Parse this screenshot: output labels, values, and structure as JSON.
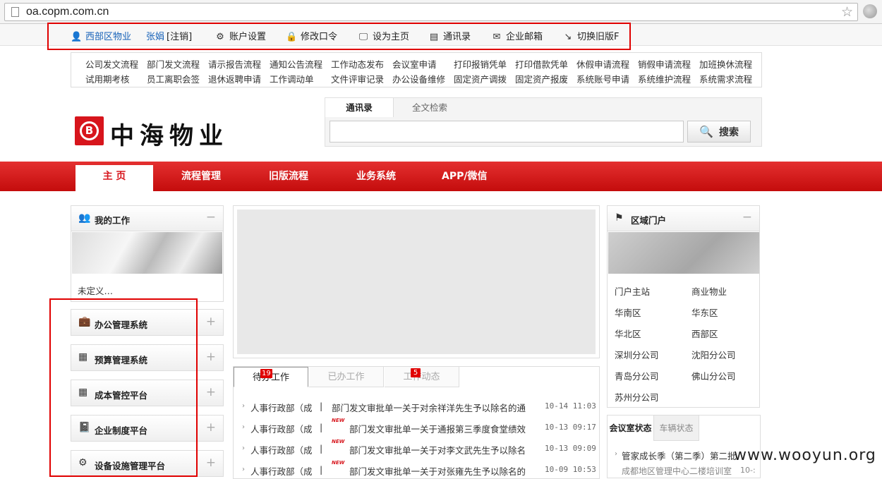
{
  "browser": {
    "url": "oa.copm.com.cn"
  },
  "userbar": {
    "org": "西部区物业",
    "user": "张娟",
    "logout": "[注销]",
    "items": [
      "账户设置",
      "修改口令",
      "设为主页",
      "通讯录",
      "企业邮箱",
      "切换旧版F"
    ]
  },
  "quicklinks": {
    "row1": [
      "公司发文流程",
      "部门发文流程",
      "请示报告流程",
      "通知公告流程",
      "工作动态发布",
      "会议室申请",
      "打印报销凭单",
      "打印借款凭单",
      "休假申请流程",
      "销假申请流程",
      "加班换休流程"
    ],
    "row2": [
      "试用期考核",
      "员工离职会签",
      "退休返聘申请",
      "工作调动单",
      "文件评审记录",
      "办公设备维修",
      "固定资产调拨",
      "固定资产报废",
      "系统账号申请",
      "系统维护流程",
      "系统需求流程"
    ]
  },
  "logo": {
    "text": "中海物业",
    "mark": "B"
  },
  "search": {
    "tabs": [
      "通讯录",
      "全文检索"
    ],
    "input_value": "",
    "button": "搜索"
  },
  "nav": [
    "主 页",
    "流程管理",
    "旧版流程",
    "业务系统",
    "APP/微信"
  ],
  "mywork": {
    "title": "我的工作",
    "toggle": "−",
    "caption": "未定义…"
  },
  "systems": [
    {
      "label": "办公管理系统",
      "icon": "briefcase-icon"
    },
    {
      "label": "预算管理系统",
      "icon": "calculator-icon"
    },
    {
      "label": "成本管控平台",
      "icon": "calculator-icon"
    },
    {
      "label": "企业制度平台",
      "icon": "book-icon"
    },
    {
      "label": "设备设施管理平台",
      "icon": "gear-icon"
    }
  ],
  "system_toggle": "+",
  "worktabs": [
    {
      "label": "待办工作",
      "badge": "19"
    },
    {
      "label": "已办工作",
      "badge": ""
    },
    {
      "label": "工作动态",
      "badge": "5"
    }
  ],
  "workitems": [
    {
      "dept": "人事行政部（成",
      "sep": "|",
      "new": false,
      "title": "部门发文审批单一关于对余祥洋先生予以除名的通",
      "time": "10-14 11:03"
    },
    {
      "dept": "人事行政部（成",
      "sep": "|",
      "new": true,
      "title": "部门发文审批单一关于通报第三季度食堂绩效",
      "time": "10-13 09:17"
    },
    {
      "dept": "人事行政部（成",
      "sep": "|",
      "new": true,
      "title": "部门发文审批单一关于对李文武先生予以除名",
      "time": "10-13 09:09"
    },
    {
      "dept": "人事行政部（成",
      "sep": "|",
      "new": true,
      "title": "部门发文审批单一关于对张雍先生予以除名的",
      "time": "10-09 10:53"
    }
  ],
  "new_label": "NEW",
  "regions": {
    "title": "区域门户",
    "toggle": "−",
    "items": [
      "门户主站",
      "商业物业",
      "华南区",
      "华东区",
      "华北区",
      "西部区",
      "深圳分公司",
      "沈阳分公司",
      "青岛分公司",
      "佛山分公司",
      "苏州分公司"
    ]
  },
  "meeting": {
    "tabs": [
      "会议室状态",
      "车辆状态"
    ],
    "line1": "管家成长季（第二季）第二批",
    "line2": "成都地区管理中心二楼培训室",
    "line2_time": "10-:"
  },
  "watermark": "www.wooyun.org",
  "colors": {
    "brand_red": "#d7151c",
    "highlight_red": "#e00000",
    "link_blue": "#1762b8"
  }
}
